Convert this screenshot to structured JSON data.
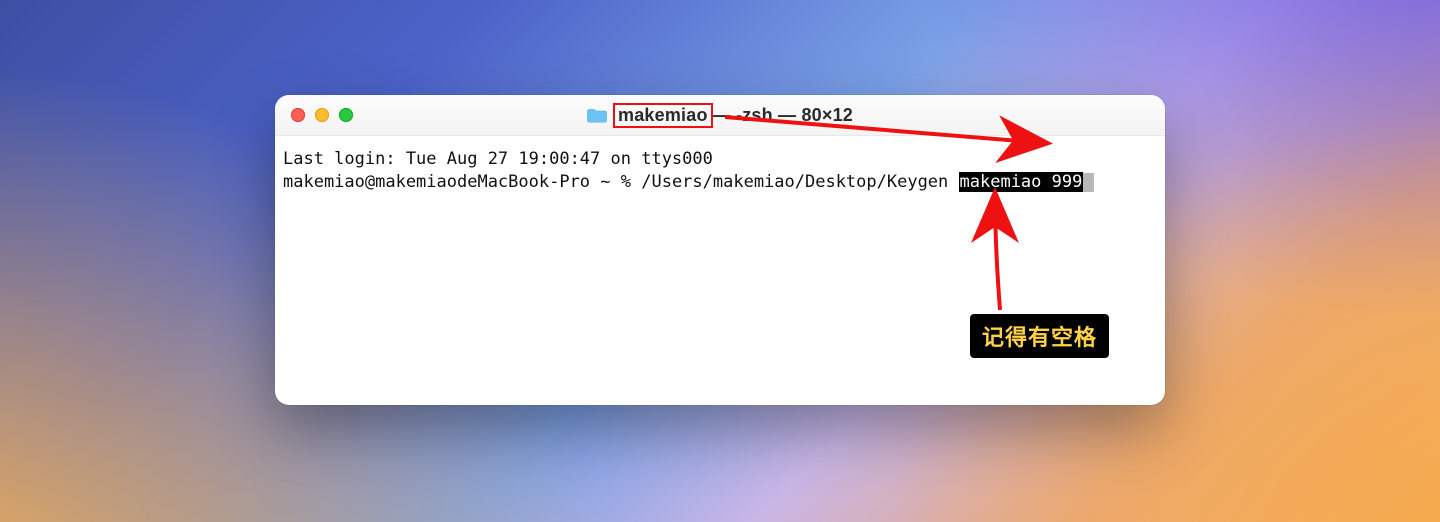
{
  "window": {
    "title_highlighted": "makemiao",
    "title_rest": " — -zsh — 80×12"
  },
  "terminal": {
    "last_login_line": "Last login: Tue Aug 27 19:00:47 on ttys000",
    "prompt": "makemiao@makemiaodeMacBook-Pro ~ % ",
    "command_path": "/Users/makemiao/Desktop/Keygen ",
    "selected_args": "makemiao 999"
  },
  "annotation": {
    "label_text": "记得有空格"
  }
}
